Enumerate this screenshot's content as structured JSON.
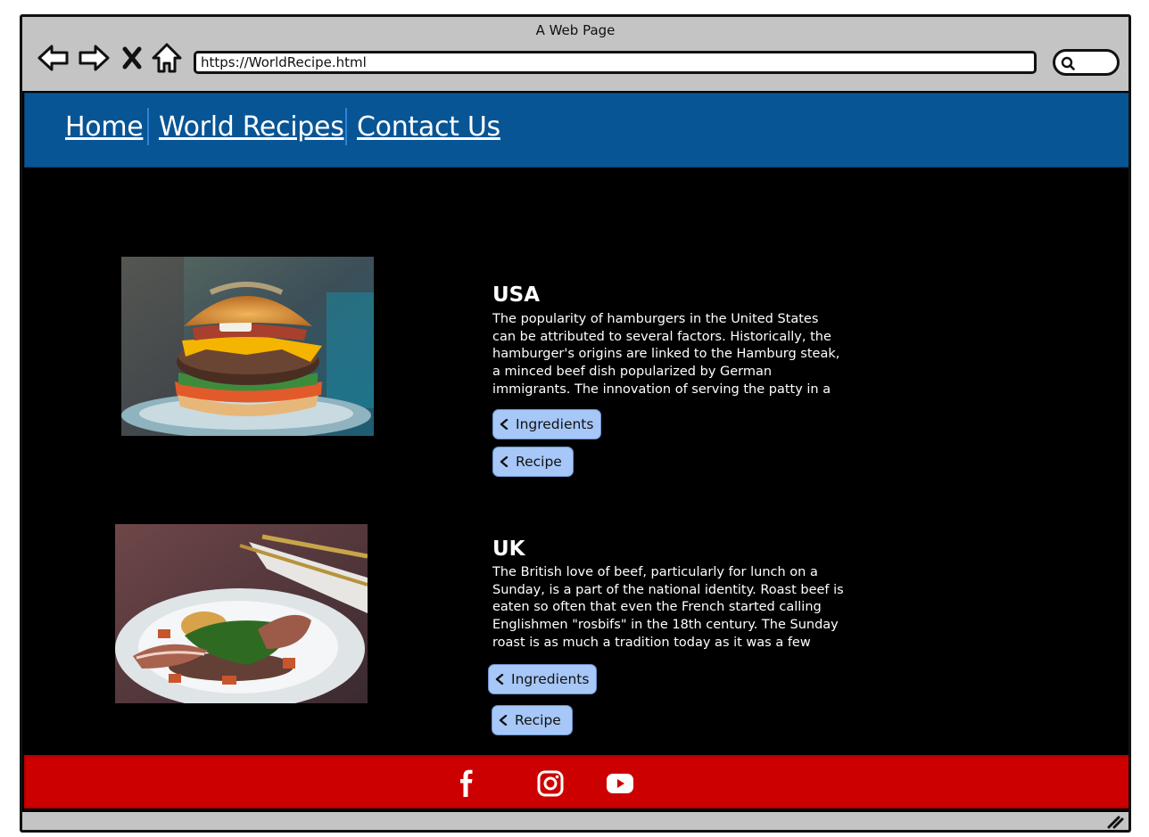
{
  "browser": {
    "window_title": "A Web Page",
    "url": "https://WorldRecipe.html",
    "icons": [
      "back-arrow-icon",
      "forward-arrow-icon",
      "close-x-icon",
      "home-icon",
      "search-icon"
    ]
  },
  "nav": {
    "items": [
      {
        "label": "Home"
      },
      {
        "label": "World Recipes"
      },
      {
        "label": "Contact Us"
      }
    ],
    "background_color": "#085596"
  },
  "recipes": [
    {
      "country": "USA",
      "image": "hamburger-photo",
      "description": "The popularity of hamburgers in the United States can be attributed to several factors. Historically, the hamburger's origins are linked to the Hamburg steak, a minced beef dish popularized by German immigrants. The innovation of serving the patty in a",
      "ingredients_label": "Ingredients",
      "recipe_label": "Recipe"
    },
    {
      "country": "UK",
      "image": "roast-beef-plate-photo",
      "description": "The British love of beef, particularly for lunch on a Sunday, is a part of the national identity. Roast beef is eaten so often that even the French started calling Englishmen \"rosbifs\" in the 18th century. The Sunday roast is as much a tradition today as it was a few",
      "ingredients_label": "Ingredients",
      "recipe_label": "Recipe"
    }
  ],
  "footer": {
    "social": [
      "facebook-icon",
      "instagram-icon",
      "youtube-icon"
    ],
    "background_color": "#cc0000"
  }
}
